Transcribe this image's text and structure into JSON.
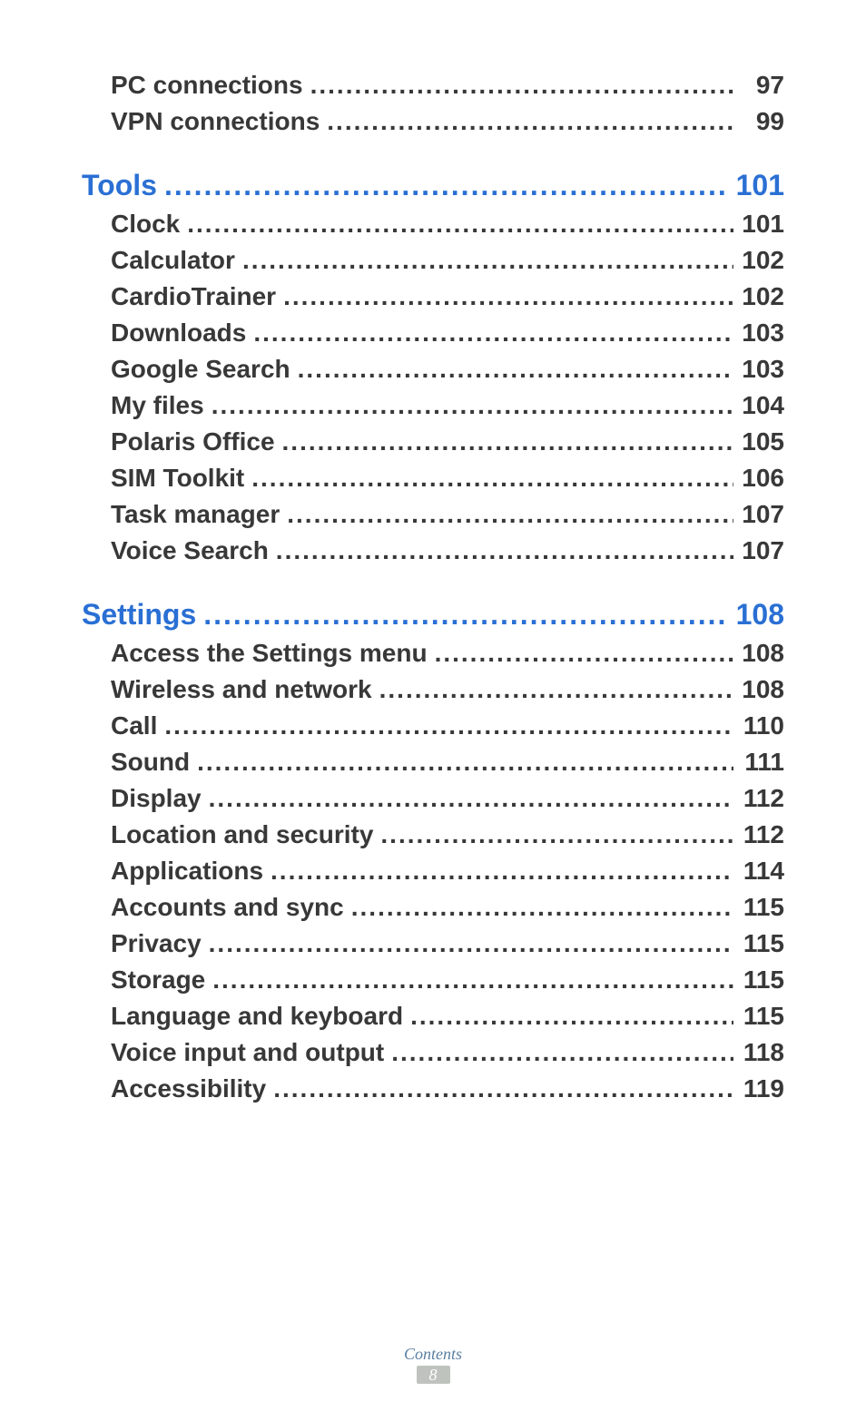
{
  "toc": [
    {
      "level": 2,
      "label": "PC connections",
      "page": "97"
    },
    {
      "level": 2,
      "label": "VPN connections",
      "page": "99"
    },
    {
      "level": 1,
      "label": "Tools",
      "page": "101"
    },
    {
      "level": 2,
      "label": "Clock",
      "page": "101"
    },
    {
      "level": 2,
      "label": "Calculator",
      "page": "102"
    },
    {
      "level": 2,
      "label": "CardioTrainer",
      "page": "102"
    },
    {
      "level": 2,
      "label": "Downloads",
      "page": "103"
    },
    {
      "level": 2,
      "label": "Google Search",
      "page": "103"
    },
    {
      "level": 2,
      "label": "My files",
      "page": "104"
    },
    {
      "level": 2,
      "label": "Polaris Office",
      "page": "105"
    },
    {
      "level": 2,
      "label": "SIM Toolkit",
      "page": "106"
    },
    {
      "level": 2,
      "label": "Task manager",
      "page": "107"
    },
    {
      "level": 2,
      "label": "Voice Search",
      "page": "107"
    },
    {
      "level": 1,
      "label": "Settings",
      "page": "108"
    },
    {
      "level": 2,
      "label": "Access the Settings menu",
      "page": "108"
    },
    {
      "level": 2,
      "label": "Wireless and network",
      "page": "108"
    },
    {
      "level": 2,
      "label": "Call",
      "page": "110"
    },
    {
      "level": 2,
      "label": "Sound",
      "page": "111"
    },
    {
      "level": 2,
      "label": "Display",
      "page": "112"
    },
    {
      "level": 2,
      "label": "Location and security",
      "page": "112"
    },
    {
      "level": 2,
      "label": "Applications",
      "page": "114"
    },
    {
      "level": 2,
      "label": "Accounts and sync",
      "page": "115"
    },
    {
      "level": 2,
      "label": "Privacy",
      "page": "115"
    },
    {
      "level": 2,
      "label": "Storage",
      "page": "115"
    },
    {
      "level": 2,
      "label": "Language and keyboard",
      "page": "115"
    },
    {
      "level": 2,
      "label": "Voice input and output",
      "page": "118"
    },
    {
      "level": 2,
      "label": "Accessibility",
      "page": "119"
    }
  ],
  "footer": {
    "title": "Contents",
    "page_number": "8"
  }
}
